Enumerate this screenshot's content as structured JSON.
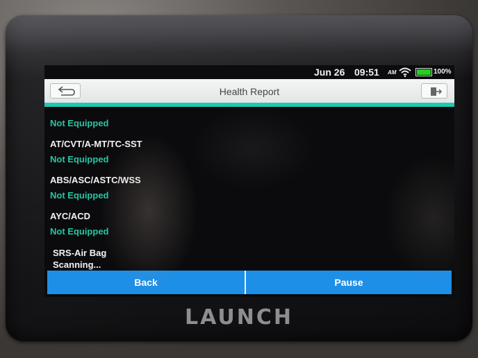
{
  "status": {
    "date": "Jun 26",
    "time": "09:51",
    "ampm": "AM",
    "battery": "100%",
    "battery_color": "#22d022"
  },
  "header": {
    "title": "Health Report",
    "back_icon": "back-arrow-icon",
    "exit_icon": "exit-icon"
  },
  "accent_color": "#20c8b0",
  "status_color": "#26c6a6",
  "items": [
    {
      "name": "",
      "status": "Not Equipped"
    },
    {
      "name": "AT/CVT/A-MT/TC-SST",
      "status": "Not Equipped"
    },
    {
      "name": "ABS/ASC/ASTC/WSS",
      "status": "Not Equipped"
    },
    {
      "name": "AYC/ACD",
      "status": "Not Equipped"
    },
    {
      "name": "SRS-Air Bag",
      "status": "Scanning..."
    }
  ],
  "buttons": {
    "back": "Back",
    "pause": "Pause",
    "color": "#1e8fe6"
  },
  "brand": "LAUNCH"
}
